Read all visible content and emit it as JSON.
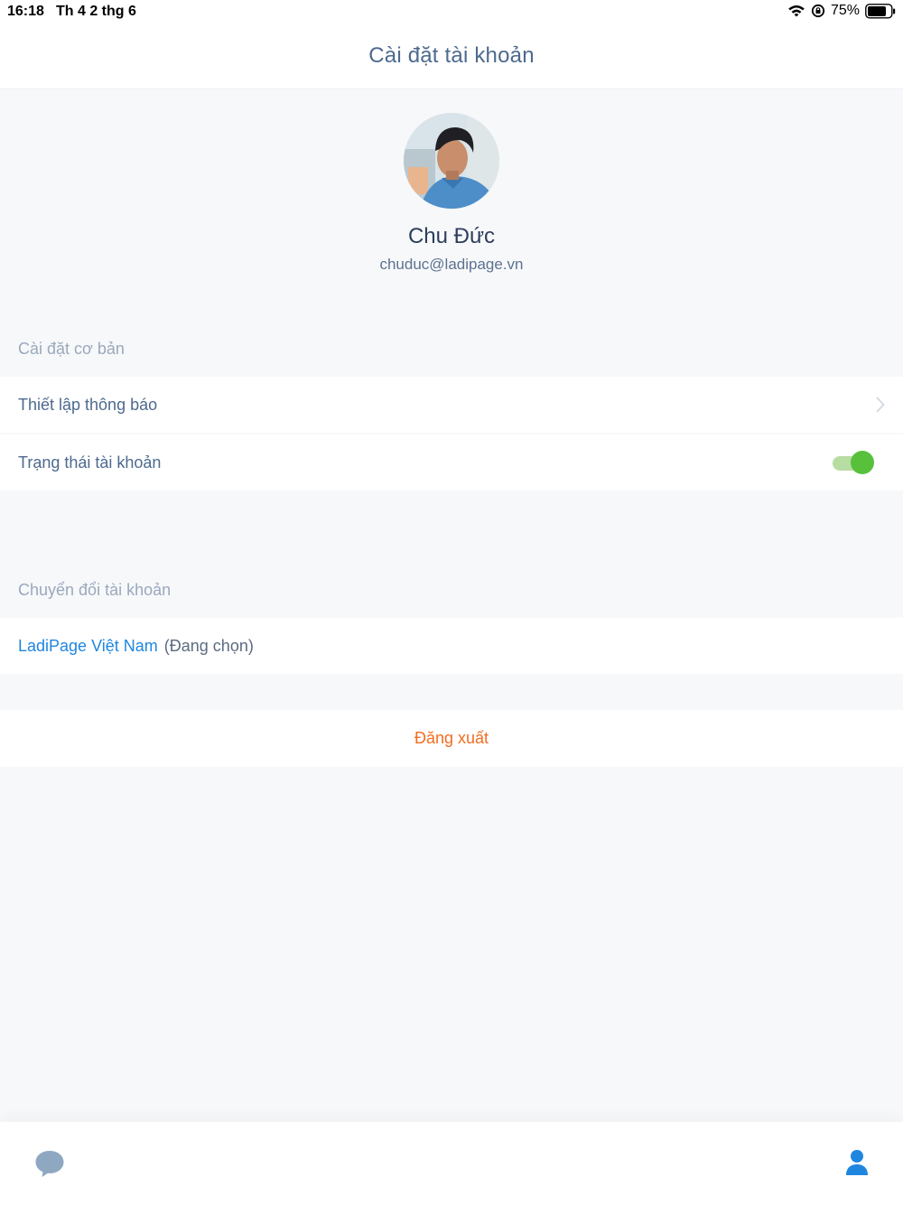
{
  "status_bar": {
    "time": "16:18",
    "date": "Th 4 2 thg 6",
    "battery": "75%"
  },
  "header": {
    "title": "Cài đặt tài khoản"
  },
  "profile": {
    "name": "Chu Đức",
    "email": "chuduc@ladipage.vn"
  },
  "basic_settings": {
    "label": "Cài đặt cơ bản",
    "notification_label": "Thiết lập thông báo",
    "account_status_label": "Trạng thái tài khoản",
    "account_status_on": true
  },
  "switch_account": {
    "label": "Chuyển đổi tài khoản",
    "current_account": "LadiPage Việt Nam",
    "current_note": "(Đang chọn)"
  },
  "logout_label": "Đăng xuất",
  "colors": {
    "accent": "#1f86e0",
    "logout": "#f26d21",
    "toggle_on": "#58c13c"
  },
  "tabs": [
    {
      "icon": "chat-icon"
    },
    {
      "icon": "user-icon"
    }
  ]
}
